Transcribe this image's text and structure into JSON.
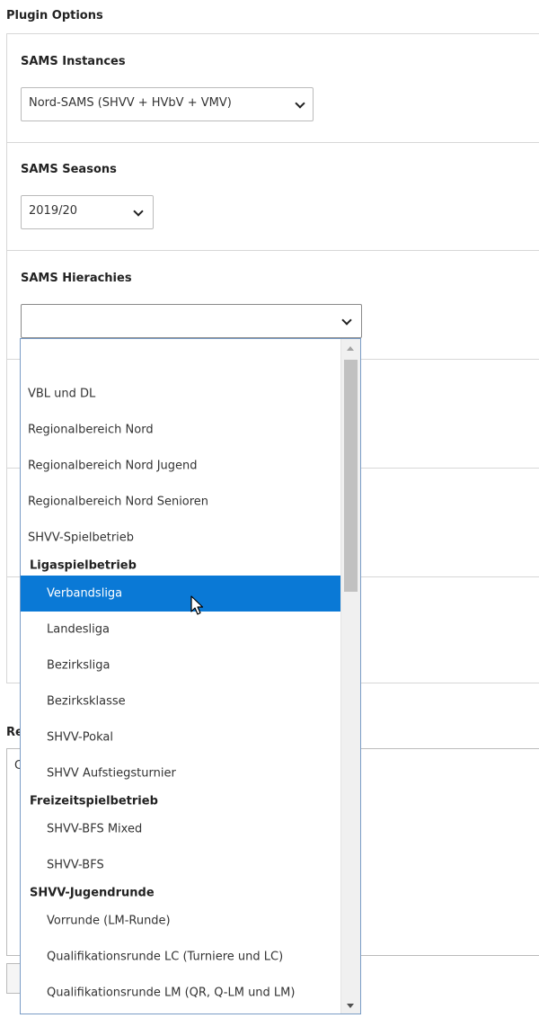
{
  "page": {
    "heading": "Plugin Options"
  },
  "instances": {
    "label": "SAMS Instances",
    "selected": "Nord-SAMS (SHVV + HVbV + VMV)"
  },
  "seasons": {
    "label": "SAMS Seasons",
    "selected": "2019/20"
  },
  "hierarchies": {
    "label": "SAMS Hierachies",
    "selected": "",
    "options": [
      {
        "kind": "option",
        "label": "",
        "indent": false
      },
      {
        "kind": "option",
        "label": "VBL und DL",
        "indent": false
      },
      {
        "kind": "option",
        "label": "Regionalbereich Nord",
        "indent": false
      },
      {
        "kind": "option",
        "label": "Regionalbereich Nord Jugend",
        "indent": false
      },
      {
        "kind": "option",
        "label": "Regionalbereich Nord Senioren",
        "indent": false
      },
      {
        "kind": "option",
        "label": "SHVV-Spielbetrieb",
        "indent": false
      },
      {
        "kind": "group",
        "label": "Ligaspielbetrieb"
      },
      {
        "kind": "option",
        "label": "Verbandsliga",
        "indent": true,
        "selected": true
      },
      {
        "kind": "option",
        "label": "Landesliga",
        "indent": true
      },
      {
        "kind": "option",
        "label": "Bezirksliga",
        "indent": true
      },
      {
        "kind": "option",
        "label": "Bezirksklasse",
        "indent": true
      },
      {
        "kind": "option",
        "label": "SHVV-Pokal",
        "indent": true
      },
      {
        "kind": "option",
        "label": "SHVV Aufstiegsturnier",
        "indent": true
      },
      {
        "kind": "group",
        "label": "Freizeitspielbetrieb"
      },
      {
        "kind": "option",
        "label": "SHVV-BFS Mixed",
        "indent": true
      },
      {
        "kind": "option",
        "label": "SHVV-BFS",
        "indent": true
      },
      {
        "kind": "group",
        "label": "SHVV-Jugendrunde"
      },
      {
        "kind": "option",
        "label": "Vorrunde (LM-Runde)",
        "indent": true
      },
      {
        "kind": "option",
        "label": "Qualifikationsrunde LC (Turniere und LC)",
        "indent": true
      },
      {
        "kind": "option",
        "label": "Qualifikationsrunde LM (QR, Q-LM und LM)",
        "indent": true
      }
    ]
  },
  "lower": {
    "label_fragment": "Re",
    "input_fragment": "C"
  },
  "colors": {
    "highlight": "#0a79d6",
    "border": "#d7d7d7",
    "dropdown_border": "#7a9cc6"
  },
  "icons": {
    "select_arrow": "chevron-down-icon",
    "cursor": "mouse-pointer-icon"
  }
}
